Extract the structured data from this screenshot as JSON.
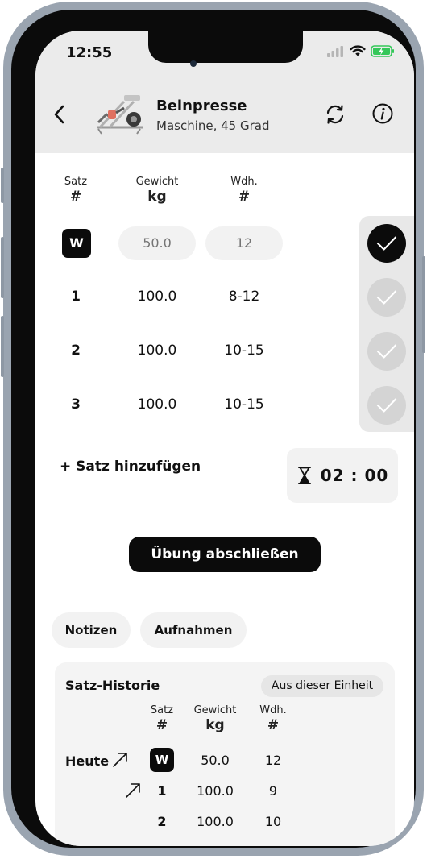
{
  "status_bar": {
    "time": "12:55"
  },
  "exercise": {
    "name": "Beinpresse",
    "subtitle": "Maschine, 45 Grad"
  },
  "columns": {
    "set": {
      "title": "Satz",
      "unit": "#"
    },
    "weight": {
      "title": "Gewicht",
      "unit": "kg"
    },
    "reps": {
      "title": "Wdh.",
      "unit": "#"
    }
  },
  "warmup": {
    "badge": "W",
    "weight_placeholder": "50.0",
    "reps_placeholder": "12",
    "completed": true
  },
  "sets": [
    {
      "number": "1",
      "weight": "100.0",
      "reps": "8-12",
      "completed": false
    },
    {
      "number": "2",
      "weight": "100.0",
      "reps": "10-15",
      "completed": false
    },
    {
      "number": "3",
      "weight": "100.0",
      "reps": "10-15",
      "completed": false
    }
  ],
  "add_set_label": "+ Satz hinzufügen",
  "rest_timer": "02 : 00",
  "finish_label": "Übung abschließen",
  "chips": {
    "notes": "Notizen",
    "recordings": "Aufnahmen"
  },
  "history": {
    "title": "Satz-Historie",
    "filter": "Aus dieser Einheit",
    "columns": {
      "set": {
        "title": "Satz",
        "unit": "#"
      },
      "weight": {
        "title": "Gewicht",
        "unit": "kg"
      },
      "reps": {
        "title": "Wdh.",
        "unit": "#"
      }
    },
    "day_label": "Heute",
    "rows": [
      {
        "set": "W",
        "weight": "50.0",
        "reps": "12"
      },
      {
        "set": "1",
        "weight": "100.0",
        "reps": "9"
      },
      {
        "set": "2",
        "weight": "100.0",
        "reps": "10"
      }
    ]
  },
  "colors": {
    "accent": "#0b0b0b",
    "header_bg": "#ebebeb",
    "battery": "#34c759"
  },
  "icons": [
    "back-icon",
    "swap-icon",
    "info-icon",
    "hourglass-icon",
    "check-icon",
    "trend-arrow-icon",
    "signal-icon",
    "wifi-icon",
    "battery-icon"
  ]
}
